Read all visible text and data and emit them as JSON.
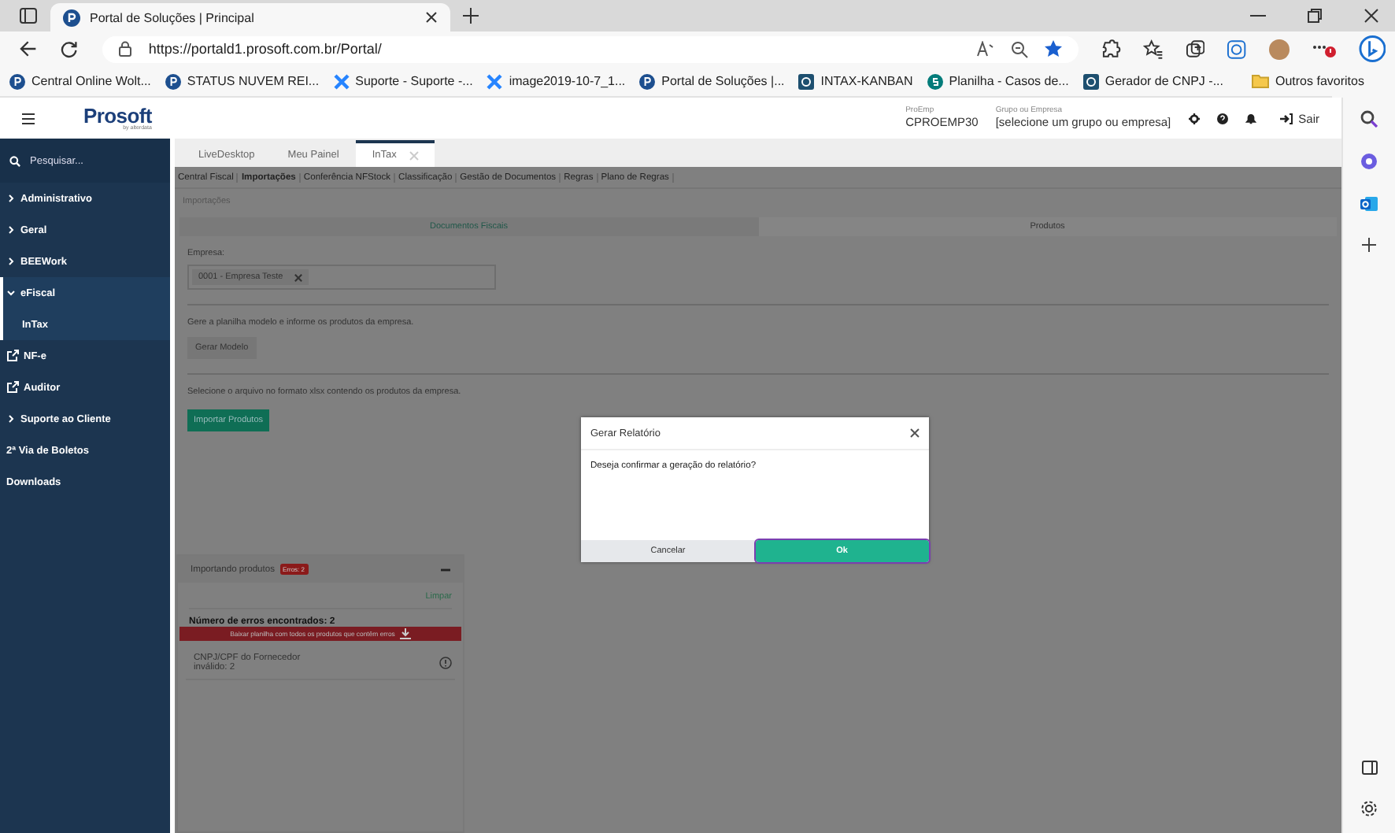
{
  "browser": {
    "tabs": [
      {
        "title": "Portal de Soluções | Principal",
        "selected": true
      }
    ],
    "address": "https://portald1.prosoft.com.br/Portal/",
    "bookmarks": [
      {
        "label": "Central Online Wolt...",
        "kind": "circle"
      },
      {
        "label": "STATUS NUVEM REI...",
        "kind": "circle"
      },
      {
        "label": "Suporte - Suporte -...",
        "kind": "cross"
      },
      {
        "label": "image2019-10-7_1...",
        "kind": "cross"
      },
      {
        "label": "Portal de Soluções |...",
        "kind": "circle"
      },
      {
        "label": "INTAX-KANBAN",
        "kind": "square"
      },
      {
        "label": "Planilha - Casos de...",
        "kind": "sheet"
      },
      {
        "label": "Gerador de CNPJ -...",
        "kind": "square"
      }
    ],
    "other_favorites": "Outros favoritos"
  },
  "header": {
    "logo": "Prosoft",
    "logo_sub": "by alterdata",
    "proemp_label": "ProEmp",
    "proemp_value": "CPROEMP30",
    "group_label": "Grupo ou Empresa",
    "group_value": "[selecione um grupo ou empresa]",
    "logout": "Sair"
  },
  "sidebar": {
    "search_placeholder": "Pesquisar...",
    "items": [
      {
        "label": "Administrativo",
        "kind": "group",
        "expanded": false,
        "selected": false
      },
      {
        "label": "Geral",
        "kind": "group",
        "expanded": false,
        "selected": false
      },
      {
        "label": "BEEWork",
        "kind": "group",
        "expanded": false,
        "selected": false
      },
      {
        "label": "eFiscal",
        "kind": "group",
        "expanded": true,
        "selected": true,
        "children": [
          {
            "label": "InTax",
            "kind": "plain",
            "selected": true
          }
        ]
      },
      {
        "label": "NF-e",
        "kind": "external",
        "selected": false
      },
      {
        "label": "Auditor",
        "kind": "external",
        "selected": false
      },
      {
        "label": "Suporte ao Cliente",
        "kind": "group",
        "expanded": false,
        "selected": false
      },
      {
        "label": "2ª Via de Boletos",
        "kind": "plain",
        "selected": false
      },
      {
        "label": "Downloads",
        "kind": "plain",
        "selected": false
      }
    ]
  },
  "page_tabs": [
    {
      "label": "LiveDesktop",
      "selected": false,
      "closable": false
    },
    {
      "label": "Meu Painel",
      "selected": false,
      "closable": false
    },
    {
      "label": "InTax",
      "selected": true,
      "closable": true
    }
  ],
  "module_nav": [
    {
      "label": "Central Fiscal",
      "selected": false
    },
    {
      "label": "Importações",
      "selected": true
    },
    {
      "label": "Conferência NFStock",
      "selected": false
    },
    {
      "label": "Classificação",
      "selected": false
    },
    {
      "label": "Gestão de Documentos",
      "selected": false
    },
    {
      "label": "Regras",
      "selected": false
    },
    {
      "label": "Plano de Regras",
      "selected": false
    }
  ],
  "breadcrumb": "Importações",
  "import_tabs": [
    {
      "label": "Documentos Fiscais",
      "selected": false
    },
    {
      "label": "Produtos",
      "selected": true
    }
  ],
  "form": {
    "company_label": "Empresa:",
    "company_chip": "0001 - Empresa Teste",
    "model_hint": "Gere a planilha modelo e informe os produtos da empresa.",
    "model_button": "Gerar Modelo",
    "file_hint": "Selecione o arquivo no formato xlsx contendo os produtos da empresa.",
    "import_button": "Importar Produtos"
  },
  "import_panel": {
    "title": "Importando produtos",
    "badge": "Erros: 2",
    "clear": "Limpar",
    "error_count": "Número de erros encontrados: 2",
    "download": "Baixar planilha com todos os produtos que contêm erros",
    "errors": [
      "CNPJ/CPF do Fornecedor inválido: 2"
    ]
  },
  "modal": {
    "title": "Gerar Relatório",
    "message": "Deseja confirmar a geração do relatório?",
    "cancel": "Cancelar",
    "ok": "Ok",
    "ok_focused": true
  }
}
